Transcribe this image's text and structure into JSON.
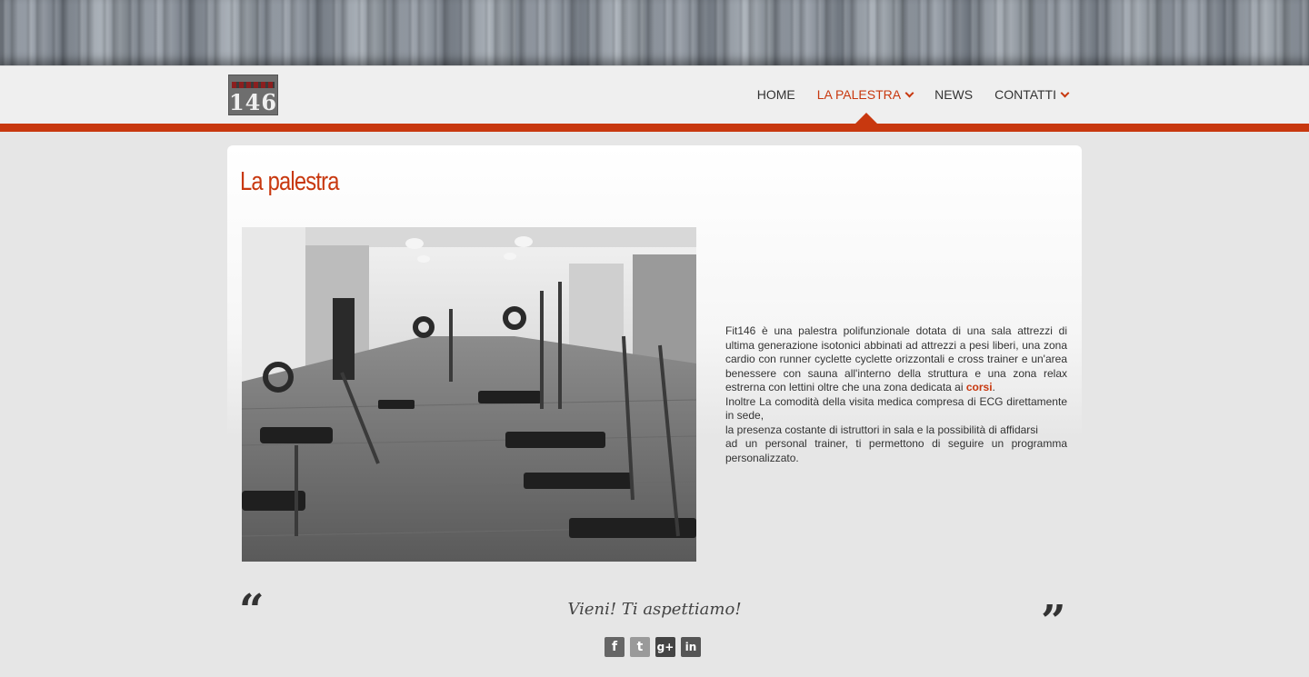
{
  "header": {
    "logo_text": "146",
    "nav": [
      {
        "label": "HOME",
        "active": false,
        "dropdown": false
      },
      {
        "label": "LA PALESTRA",
        "active": true,
        "dropdown": true
      },
      {
        "label": "NEWS",
        "active": false,
        "dropdown": false
      },
      {
        "label": "CONTATTI",
        "active": false,
        "dropdown": true
      }
    ]
  },
  "main": {
    "title": "La palestra",
    "description": {
      "p1_before": "Fit146 è una palestra polifunzionale dotata di una sala attrezzi di ultima generazione isotonici abbinati ad attrezzi a pesi liberi, una zona cardio con runner cyclette cyclette orizzontali e cross trainer e un'area benessere con sauna all'interno della struttura e una zona relax estrerna con lettini oltre che una zona dedicata ai ",
      "p1_link": "corsi",
      "p1_after": ".",
      "p2": "Inoltre La comodità della visita medica compresa di ECG direttamente in sede,",
      "p3": "la presenza costante di istruttori in sala e la possibilità di affidarsi",
      "p4": "ad un personal trainer, ti permettono di seguire un programma personalizzato."
    },
    "quote": {
      "open": "“",
      "text": "Vieni! Ti aspettiamo!",
      "close": "”"
    }
  },
  "social": [
    {
      "name": "facebook",
      "glyph": "f"
    },
    {
      "name": "twitter",
      "glyph": "t"
    },
    {
      "name": "google-plus",
      "glyph": "g+"
    },
    {
      "name": "linkedin",
      "glyph": "in"
    }
  ],
  "colors": {
    "accent": "#c8380f",
    "background": "#e6e6e6",
    "text": "#333333"
  }
}
